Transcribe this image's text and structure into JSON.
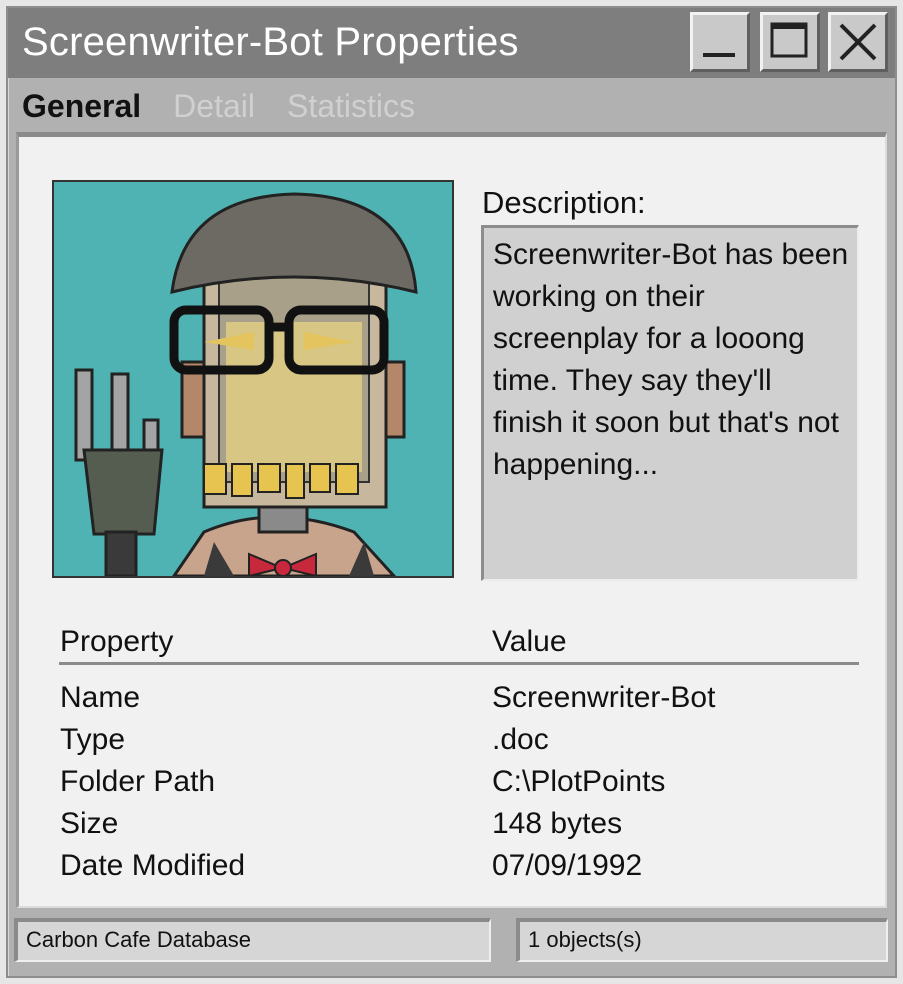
{
  "window": {
    "title": "Screenwriter-Bot Properties",
    "controls": {
      "minimize": "minimize-icon",
      "maximize": "maximize-icon",
      "close": "close-icon"
    }
  },
  "tabs": [
    {
      "label": "General",
      "active": true
    },
    {
      "label": "Detail",
      "active": false
    },
    {
      "label": "Statistics",
      "active": false
    }
  ],
  "description": {
    "label": "Description:",
    "text": "Screenwriter-Bot has been working on their screenplay for a looong time. They say they'll finish it soon but that's not happening..."
  },
  "properties": {
    "headers": {
      "property": "Property",
      "value": "Value"
    },
    "rows": [
      {
        "property": "Name",
        "value": "Screenwriter-Bot"
      },
      {
        "property": "Type",
        "value": ".doc"
      },
      {
        "property": "Folder Path",
        "value": "C:\\PlotPoints"
      },
      {
        "property": "Size",
        "value": "148 bytes"
      },
      {
        "property": "Date Modified",
        "value": "07/09/1992"
      }
    ]
  },
  "statusbar": {
    "left": "Carbon Cafe Database",
    "right": "1 objects(s)"
  },
  "colors": {
    "titlebar": "#7e7e7e",
    "portrait_bg": "#4fb3b3",
    "panel": "#f1f1f1"
  }
}
